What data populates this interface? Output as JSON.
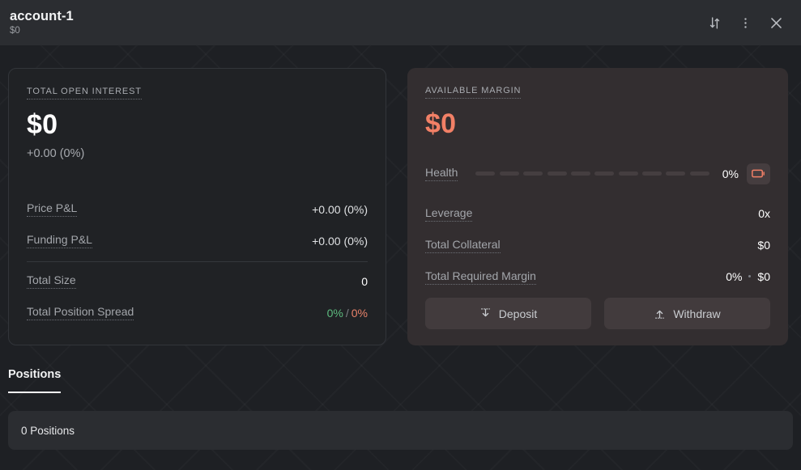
{
  "header": {
    "account_name": "account-1",
    "account_value": "$0",
    "icons": {
      "transfer": "sort-transfer-icon",
      "menu": "more-vertical-icon",
      "close": "close-icon"
    }
  },
  "open_interest_card": {
    "eyebrow": "TOTAL OPEN INTEREST",
    "value": "$0",
    "delta": "+0.00 (0%)",
    "rows": [
      {
        "label": "Price P&L",
        "value": "+0.00 (0%)"
      },
      {
        "label": "Funding P&L",
        "value": "+0.00 (0%)"
      }
    ],
    "total_size": {
      "label": "Total Size",
      "value": "0"
    },
    "total_position_spread": {
      "label": "Total Position Spread",
      "positive": "0%",
      "separator": "/",
      "negative": "0%"
    }
  },
  "available_margin_card": {
    "eyebrow": "AVAILABLE MARGIN",
    "value": "$0",
    "health": {
      "label": "Health",
      "percent": "0%",
      "segments_total": 10,
      "segments_filled": 0,
      "battery_icon": "battery-empty-icon"
    },
    "rows": [
      {
        "label": "Leverage",
        "value": "0x"
      },
      {
        "label": "Total Collateral",
        "value": "$0"
      }
    ],
    "total_required_margin": {
      "label": "Total Required Margin",
      "percent": "0%",
      "amount": "$0"
    },
    "buttons": {
      "deposit": "Deposit",
      "withdraw": "Withdraw",
      "deposit_icon": "arrow-down-to-line-icon",
      "withdraw_icon": "arrow-up-from-line-icon"
    }
  },
  "tabs": [
    {
      "label": "Positions",
      "active": true
    }
  ],
  "positions_panel": {
    "empty_text": "0 Positions"
  },
  "colors": {
    "accent_coral": "#f28066",
    "positive_green": "#5dbb7f",
    "negative_coral": "#e8826a",
    "header_bg": "#2b2d31",
    "body_bg": "#1e2024",
    "card_left_bg": "#202225",
    "card_right_bg": "#332e30"
  }
}
